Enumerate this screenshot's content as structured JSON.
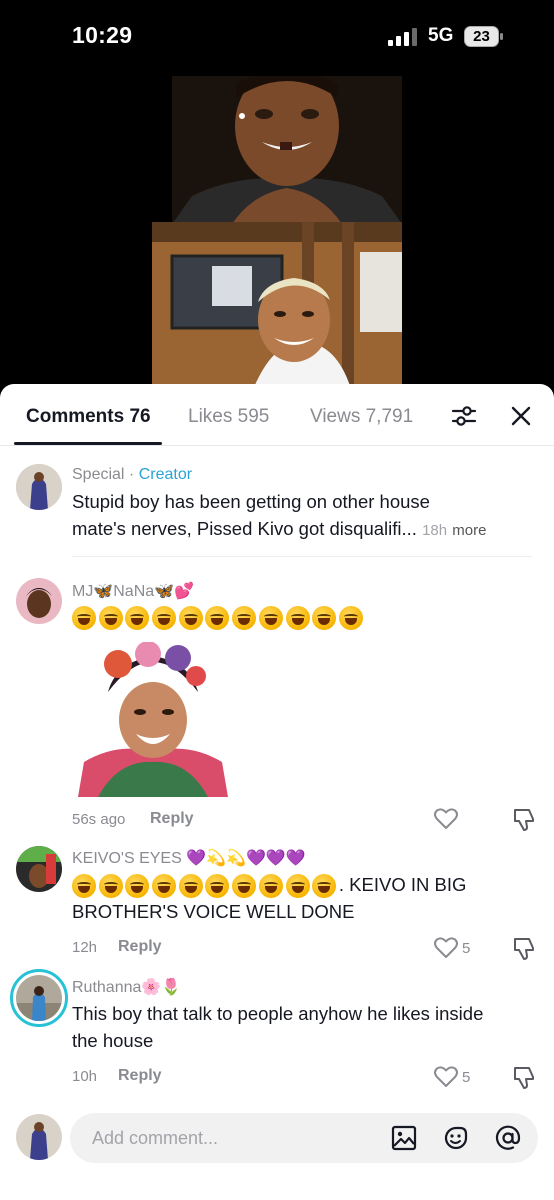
{
  "status_bar": {
    "time": "10:29",
    "network": "5G",
    "battery": "23"
  },
  "tabs": [
    {
      "label": "Comments 76",
      "active": true
    },
    {
      "label": "Likes 595",
      "active": false
    },
    {
      "label": "Views 7,791",
      "active": false
    }
  ],
  "comments": [
    {
      "username": "Special",
      "separator": " · ",
      "badge": "Creator",
      "text_line1": "Stupid boy has been getting on other house",
      "text_line2": "mate's nerves, Pissed Kivo got disqualifi...",
      "time": "18h",
      "more_label": "more"
    },
    {
      "username": "MJ🦋NaNa🦋💕",
      "emoji_count": 11,
      "time": "56s ago",
      "reply_label": "Reply"
    },
    {
      "username": "KEIVO'S EYES 💜💫💫💜💜💜",
      "text_suffix": ". KEIVO IN BIG",
      "text_line2": "BROTHER'S VOICE WELL DONE",
      "emoji_count": 10,
      "time": "12h",
      "reply_label": "Reply",
      "likes": "5"
    },
    {
      "username": "Ruthanna🌸🌷",
      "text_line1": "This boy that talk to people anyhow he likes inside",
      "text_line2": "the house",
      "time": "10h",
      "reply_label": "Reply",
      "likes": "5"
    }
  ],
  "input": {
    "placeholder": "Add comment..."
  },
  "icons": {
    "filter": "filter-icon",
    "close": "close-icon",
    "heart": "heart-icon",
    "dislike": "dislike-icon",
    "image": "image-icon",
    "emoji": "emoji-icon",
    "mention": "at-icon"
  },
  "colors": {
    "accent_creator": "#2aa3d6",
    "text_primary": "#161823",
    "text_secondary": "#8a8b91"
  }
}
